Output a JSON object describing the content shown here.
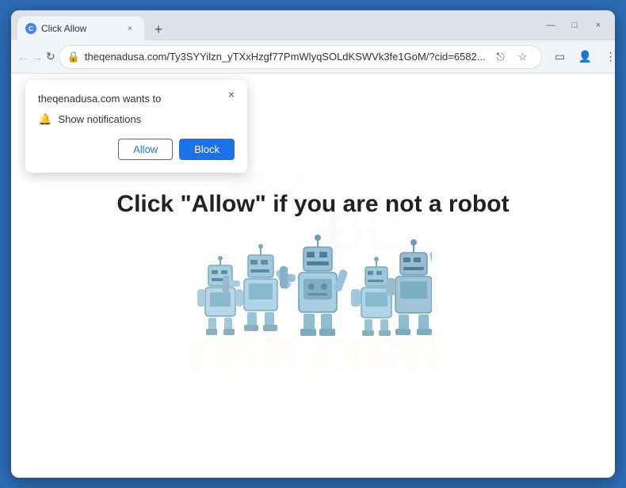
{
  "window": {
    "title": "Click Allow",
    "close_label": "×",
    "minimize_label": "—",
    "maximize_label": "□"
  },
  "tab": {
    "favicon_text": "C",
    "title": "Click Allow",
    "close_icon": "×"
  },
  "new_tab_icon": "+",
  "nav": {
    "back_icon": "←",
    "forward_icon": "→",
    "refresh_icon": "↻",
    "address": "theqenadusa.com/Ty3SYYilzn_yTXxHzgf77PmWlyqSOLdKSWVk3fe1GoM/?cid=6582...",
    "share_icon": "⎋",
    "bookmark_icon": "☆",
    "sidebar_icon": "▭",
    "profile_icon": "👤",
    "more_icon": "⋮"
  },
  "popup": {
    "title": "theqenadusa.com wants to",
    "close_icon": "×",
    "notification_text": "Show notifications",
    "allow_label": "Allow",
    "block_label": "Block"
  },
  "page": {
    "heading": "Click \"Allow\"  if you are not  a robot",
    "watermark_text": "rish.com",
    "watermark_search_label": "search-watermark"
  },
  "colors": {
    "browser_frame": "#2d6cb5",
    "allow_color": "#1a73e8",
    "block_bg": "#1a73e8"
  }
}
